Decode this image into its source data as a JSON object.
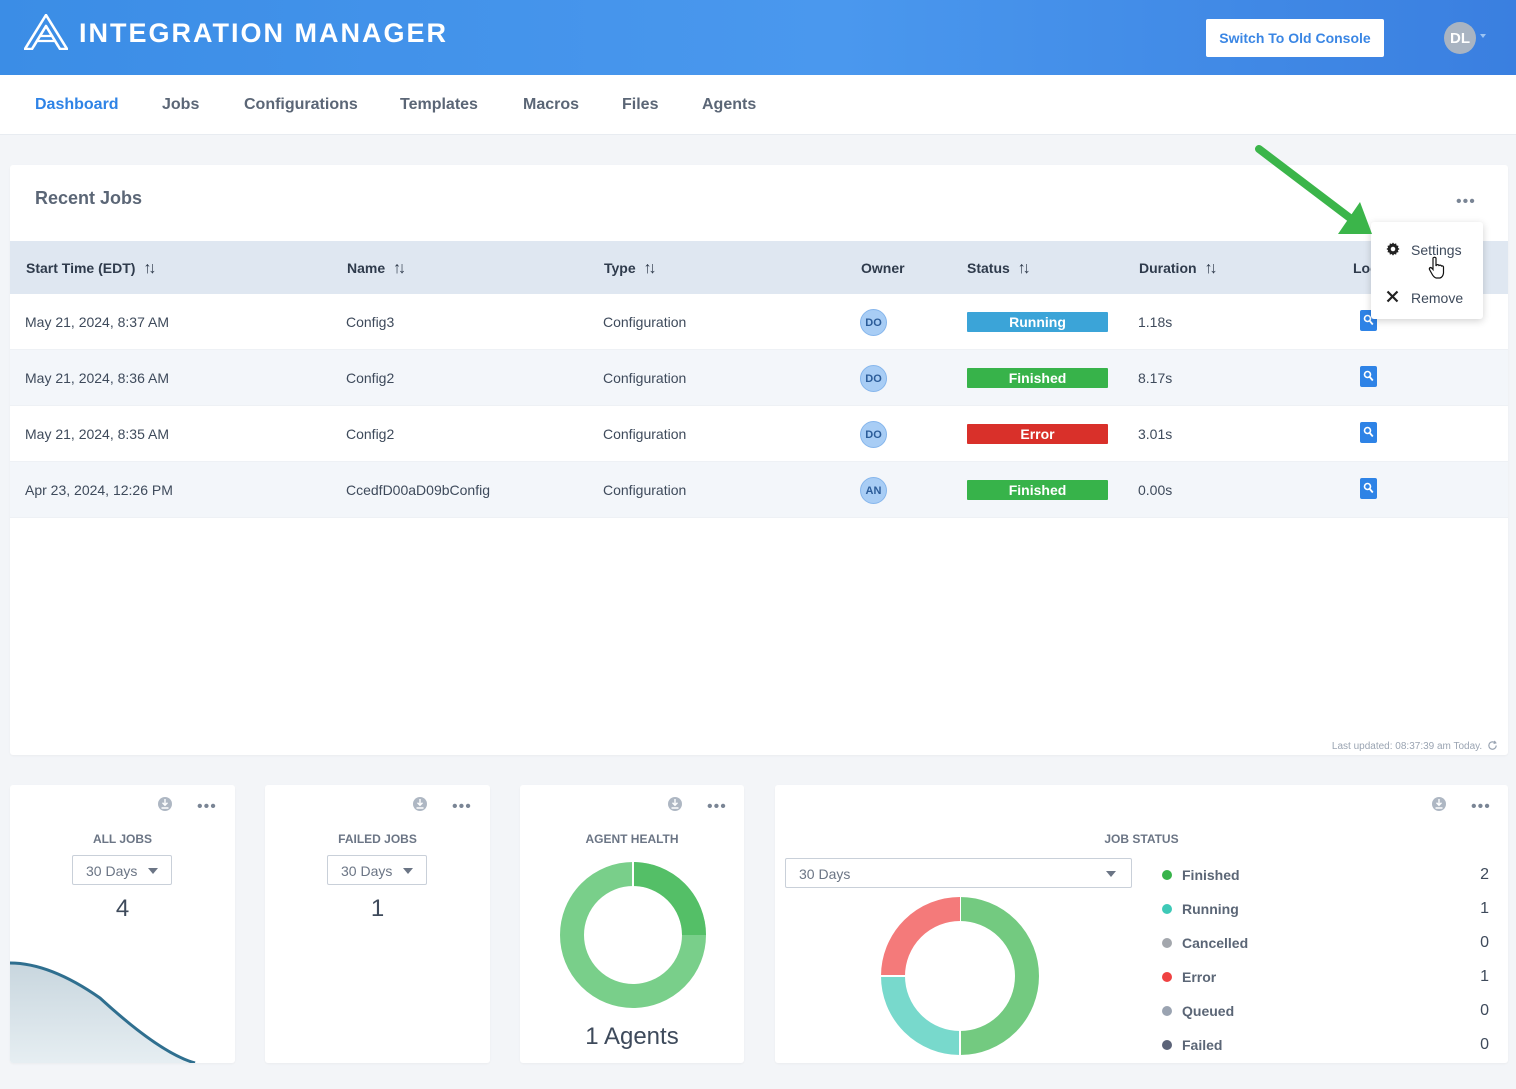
{
  "header": {
    "app_title": "INTEGRATION MANAGER",
    "switch_button": "Switch To Old Console",
    "user_initials": "DL"
  },
  "nav": {
    "items": [
      {
        "label": "Dashboard",
        "active": true
      },
      {
        "label": "Jobs",
        "active": false
      },
      {
        "label": "Configurations",
        "active": false
      },
      {
        "label": "Templates",
        "active": false
      },
      {
        "label": "Macros",
        "active": false
      },
      {
        "label": "Files",
        "active": false
      },
      {
        "label": "Agents",
        "active": false
      }
    ]
  },
  "recent_jobs": {
    "title": "Recent Jobs",
    "more": "•••",
    "columns": [
      "Start Time (EDT)",
      "Name",
      "Type",
      "Owner",
      "Status",
      "Duration",
      "Log"
    ],
    "sort_glyph": "↑↓",
    "rows": [
      {
        "start_time": "May 21, 2024, 8:37 AM",
        "name": "Config3",
        "type": "Configuration",
        "owner": "DO",
        "status": "Running",
        "status_color": "#3ba4d8",
        "duration": "1.18s"
      },
      {
        "start_time": "May 21, 2024, 8:36 AM",
        "name": "Config2",
        "type": "Configuration",
        "owner": "DO",
        "status": "Finished",
        "status_color": "#37b34a",
        "duration": "8.17s"
      },
      {
        "start_time": "May 21, 2024, 8:35 AM",
        "name": "Config2",
        "type": "Configuration",
        "owner": "DO",
        "status": "Error",
        "status_color": "#d9302a",
        "duration": "3.01s"
      },
      {
        "start_time": "Apr 23, 2024, 12:26 PM",
        "name": "CcedfD00aD09bConfig",
        "type": "Configuration",
        "owner": "AN",
        "status": "Finished",
        "status_color": "#37b34a",
        "duration": "0.00s"
      }
    ],
    "last_updated": "Last updated: 08:37:39 am Today."
  },
  "context_menu": {
    "settings": "Settings",
    "remove": "Remove"
  },
  "widgets": {
    "all_jobs": {
      "title": "ALL JOBS",
      "range": "30 Days",
      "value": "4"
    },
    "failed_jobs": {
      "title": "FAILED JOBS",
      "range": "30 Days",
      "value": "1"
    },
    "agent_health": {
      "title": "AGENT HEALTH",
      "label": "1 Agents"
    },
    "job_status": {
      "title": "JOB STATUS",
      "range": "30 Days",
      "legend": [
        {
          "name": "Finished",
          "value": "2",
          "color": "#37b34a"
        },
        {
          "name": "Running",
          "value": "1",
          "color": "#3ec9b7"
        },
        {
          "name": "Cancelled",
          "value": "0",
          "color": "#a3a7ad"
        },
        {
          "name": "Error",
          "value": "1",
          "color": "#ef4242"
        },
        {
          "name": "Queued",
          "value": "0",
          "color": "#9aa3b1"
        },
        {
          "name": "Failed",
          "value": "0",
          "color": "#5b6378"
        }
      ]
    }
  },
  "colors": {
    "accent": "#2e83e6",
    "header_gradient_start": "#3b8de6",
    "table_header": "#dfe7f1",
    "annotation_arrow": "#3bb54a"
  }
}
